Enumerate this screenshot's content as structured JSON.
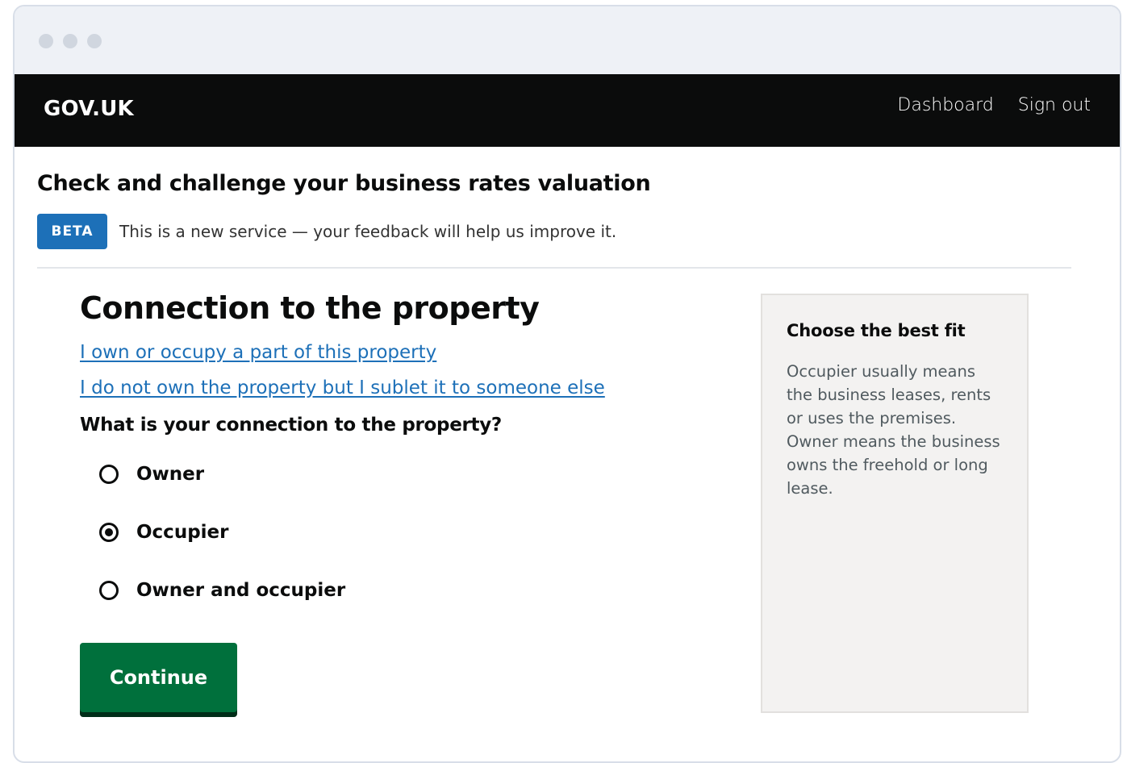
{
  "header": {
    "logo": "GOV.UK",
    "nav": [
      "Dashboard",
      "Sign out"
    ]
  },
  "service": {
    "name": "Check and challenge your business rates valuation",
    "phase_tag": "BETA",
    "phase_text": "This is a new service — your feedback will help us improve it."
  },
  "main": {
    "heading": "Connection to the property",
    "links": [
      "I own or occupy a part of this property",
      "I do not own the property but I sublet it to someone else"
    ],
    "question": "What is your connection to the property?",
    "options": [
      {
        "label": "Owner",
        "checked": false
      },
      {
        "label": "Occupier",
        "checked": true
      },
      {
        "label": "Owner and occupier",
        "checked": false
      }
    ],
    "continue_label": "Continue"
  },
  "aside": {
    "title": "Choose the best fit",
    "body": "Occupier usually means the business leases, rents or uses the premises. Owner means the business owns the freehold or long lease."
  },
  "colors": {
    "header_bg": "#0b0c0c",
    "link": "#1d70b8",
    "tag_bg": "#1d70b8",
    "button_bg": "#00703c",
    "aside_bg": "#f3f2f1"
  }
}
